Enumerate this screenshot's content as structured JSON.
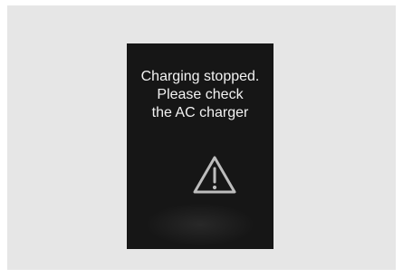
{
  "display": {
    "lines": [
      "Charging stopped.",
      "Please check",
      "the AC charger"
    ],
    "icon": "warning-triangle-icon"
  },
  "colors": {
    "outer_background": "#e6e6e6",
    "screen_background": "#161616",
    "text": "#f2f2f2",
    "icon": "#bdbdbd"
  }
}
